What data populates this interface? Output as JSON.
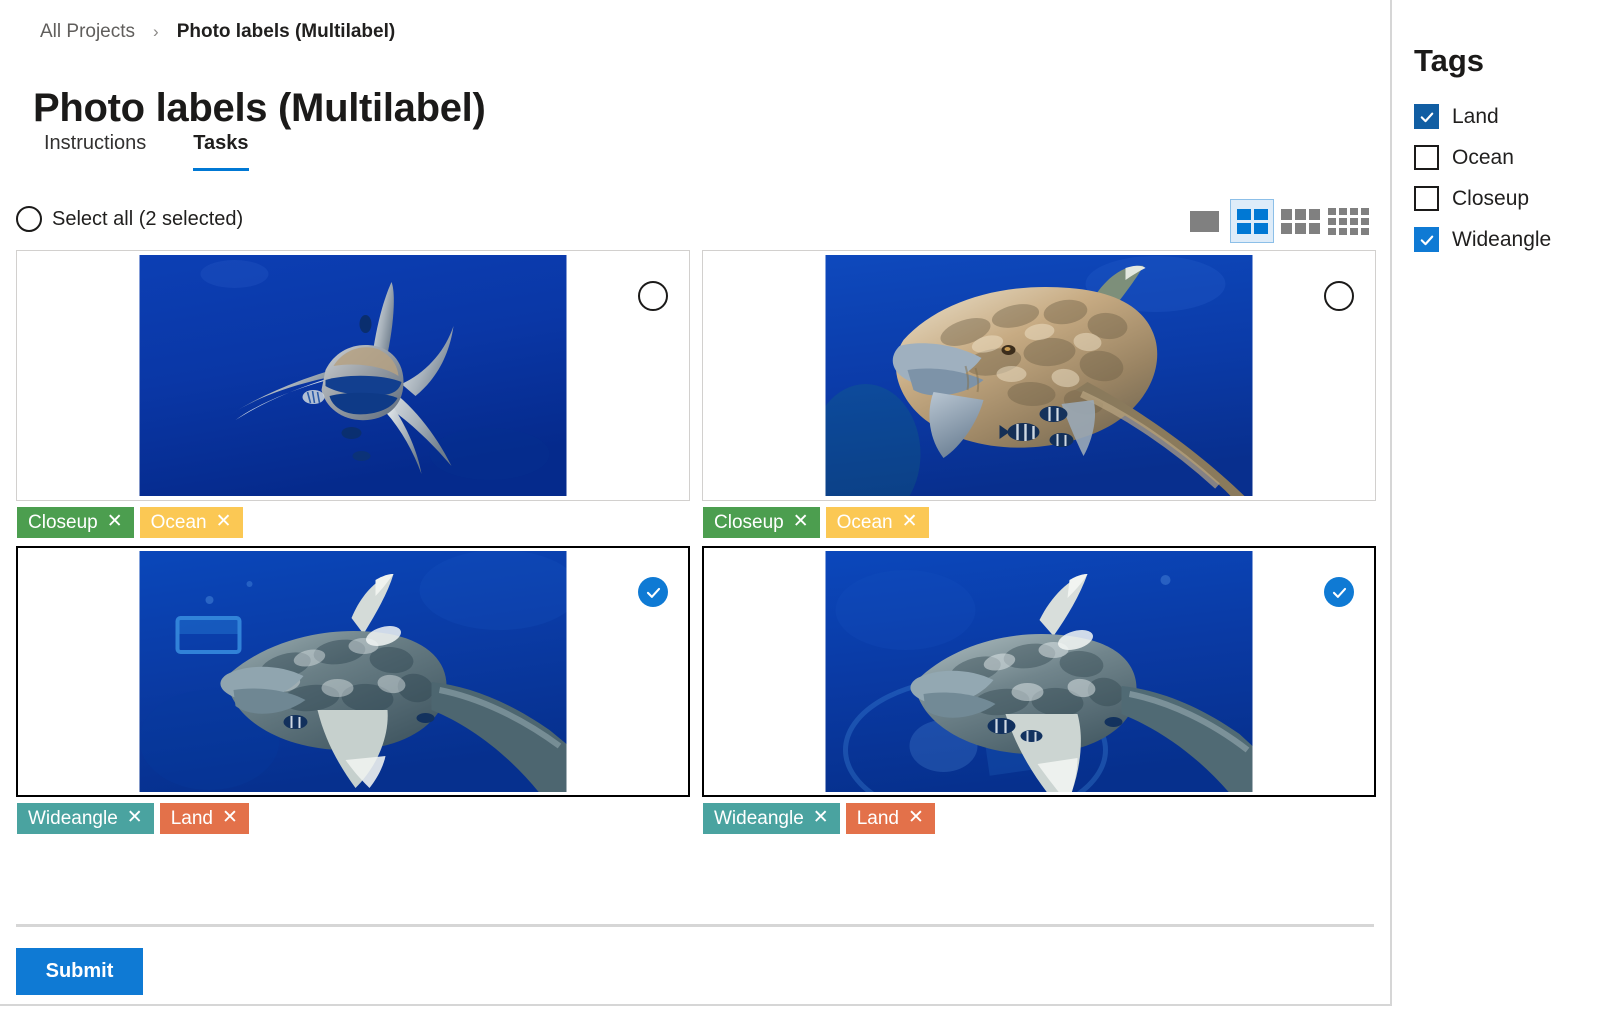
{
  "breadcrumb": {
    "root": "All Projects",
    "separator": "›",
    "current": "Photo labels (Multilabel)"
  },
  "page": {
    "title": "Photo labels (Multilabel)"
  },
  "tabs": [
    {
      "label": "Instructions",
      "active": false
    },
    {
      "label": "Tasks",
      "active": true
    }
  ],
  "toolbar": {
    "select_all_label": "Select all (2 selected)",
    "selected_count": 2,
    "view_modes": [
      {
        "name": "view-mode-single",
        "icon": "single-pane-icon",
        "cols": 1,
        "rows": 1,
        "active": false
      },
      {
        "name": "view-mode-2x2",
        "icon": "grid-2x2-icon",
        "cols": 2,
        "rows": 2,
        "active": true
      },
      {
        "name": "view-mode-3x2",
        "icon": "grid-3x2-icon",
        "cols": 3,
        "rows": 2,
        "active": false
      },
      {
        "name": "view-mode-4x3",
        "icon": "grid-4x3-icon",
        "cols": 4,
        "rows": 3,
        "active": false
      }
    ]
  },
  "cards": [
    {
      "name": "task-card-1",
      "image_alt": "Oceanic whitetip shark facing camera in deep blue water",
      "image_variant": "shark-front",
      "selected": false,
      "check_icon": "circle-unchecked-icon",
      "chips": [
        {
          "label": "Closeup",
          "color": "#4c9e4f",
          "remove_icon": "close-icon"
        },
        {
          "label": "Ocean",
          "color": "#fbc854",
          "remove_icon": "close-icon"
        }
      ]
    },
    {
      "name": "task-card-2",
      "image_alt": "Oceanic whitetip shark swimming toward camera with pilot fish",
      "image_variant": "shark-closeup",
      "selected": false,
      "check_icon": "circle-unchecked-icon",
      "chips": [
        {
          "label": "Closeup",
          "color": "#4c9e4f",
          "remove_icon": "close-icon"
        },
        {
          "label": "Ocean",
          "color": "#fbc854",
          "remove_icon": "close-icon"
        }
      ]
    },
    {
      "name": "task-card-3",
      "image_alt": "Oceanic whitetip shark wide angle view in blue water",
      "image_variant": "shark-wide-left",
      "selected": true,
      "check_icon": "circle-checked-icon",
      "chips": [
        {
          "label": "Wideangle",
          "color": "#4aa3a0",
          "remove_icon": "close-icon"
        },
        {
          "label": "Land",
          "color": "#e3714a",
          "remove_icon": "close-icon"
        }
      ]
    },
    {
      "name": "task-card-4",
      "image_alt": "Oceanic whitetip shark wide angle view from below",
      "image_variant": "shark-wide-right",
      "selected": true,
      "check_icon": "circle-checked-icon",
      "chips": [
        {
          "label": "Wideangle",
          "color": "#4aa3a0",
          "remove_icon": "close-icon"
        },
        {
          "label": "Land",
          "color": "#e3714a",
          "remove_icon": "close-icon"
        }
      ]
    }
  ],
  "footer": {
    "submit_label": "Submit"
  },
  "tags_panel": {
    "title": "Tags",
    "items": [
      {
        "label": "Land",
        "checked": true,
        "color": "#115ea3"
      },
      {
        "label": "Ocean",
        "checked": false,
        "color": ""
      },
      {
        "label": "Closeup",
        "checked": false,
        "color": ""
      },
      {
        "label": "Wideangle",
        "checked": true,
        "color": "#0f7ad4"
      }
    ]
  },
  "colors": {
    "accent": "#0f7ad4",
    "tab_underline": "#0078d4",
    "selected_border": "#000000",
    "card_border": "#d2d0ce"
  }
}
